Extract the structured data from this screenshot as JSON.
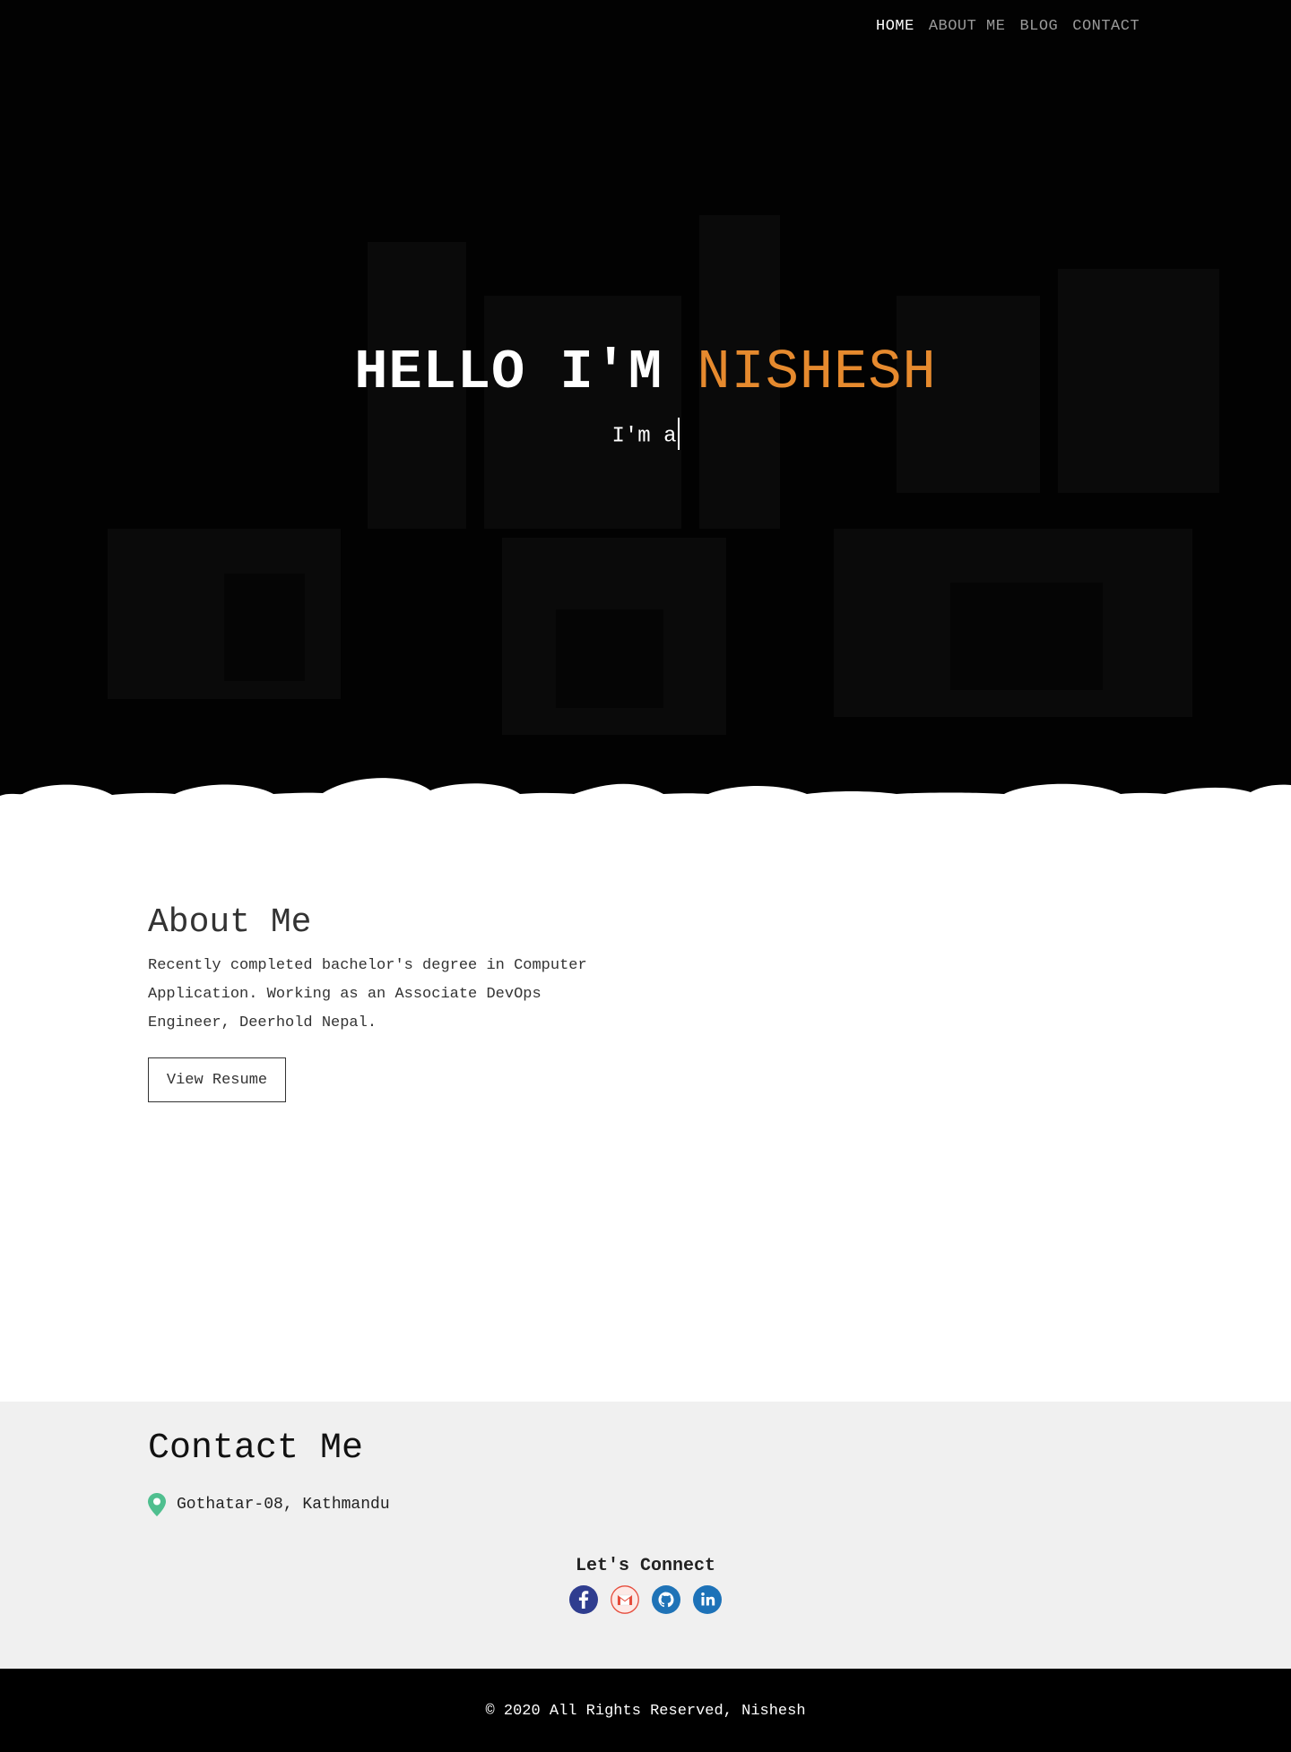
{
  "nav": {
    "items": [
      {
        "label": "HOME",
        "active": true
      },
      {
        "label": "ABOUT ME",
        "active": false
      },
      {
        "label": "BLOG",
        "active": false
      },
      {
        "label": "CONTACT",
        "active": false
      }
    ]
  },
  "hero": {
    "greeting": "HELLO I'M",
    "name": "NISHESH",
    "typed_text": "I'm a",
    "accent_color": "#e68a2e"
  },
  "about": {
    "title": "About Me",
    "text": "Recently completed bachelor's degree in Computer Application. Working as an Associate DevOps Engineer, Deerhold Nepal.",
    "button_label": "View Resume"
  },
  "contact": {
    "title": "Contact Me",
    "location_icon": "map-pin-icon",
    "location": "Gothatar-08, Kathmandu",
    "connect_title": "Let's Connect",
    "socials": [
      {
        "icon": "facebook-icon",
        "color": "#2f3d8f"
      },
      {
        "icon": "gmail-icon",
        "color": "#e64c3c"
      },
      {
        "icon": "github-icon",
        "color": "#1f73b7"
      },
      {
        "icon": "linkedin-icon",
        "color": "#1d72b8"
      }
    ]
  },
  "footer": {
    "text": "© 2020 All Rights Reserved, Nishesh"
  }
}
